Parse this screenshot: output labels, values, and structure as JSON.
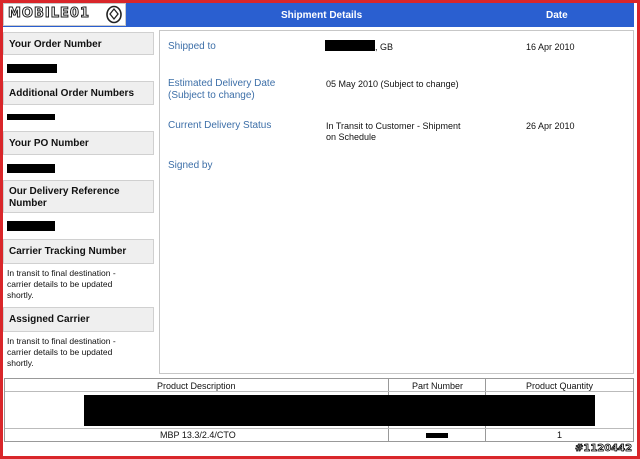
{
  "logo": {
    "text": "MOBILE01"
  },
  "header": {
    "title": "Shipment Details",
    "date_col": "Date"
  },
  "sidebar": {
    "order_number_label": "Your Order Number",
    "additional_orders_label": "Additional Order Numbers",
    "po_number_label": "Your PO Number",
    "delivery_ref_label": "Our Delivery Reference Number",
    "tracking_label": "Carrier Tracking Number",
    "tracking_value": "In transit to final destination - carrier details to be updated shortly.",
    "carrier_label": "Assigned Carrier",
    "carrier_value": "In transit to final destination - carrier details to be updated shortly."
  },
  "details": {
    "shipped_to_label": "Shipped to",
    "shipped_to_value": ", GB",
    "shipped_to_date": "16 Apr 2010",
    "est_delivery_label": "Estimated Delivery Date (Subject to change)",
    "est_delivery_value": "05 May 2010 (Subject to change)",
    "status_label": "Current Delivery Status",
    "status_value": "In Transit to Customer - Shipment on Schedule",
    "status_date": "26 Apr 2010",
    "signed_by_label": "Signed by"
  },
  "products": {
    "headers": [
      "Product Description",
      "Part Number",
      "Product Quantity"
    ],
    "rows": [
      {
        "description": "MBP 13.3/2.4/CTO",
        "part": "",
        "quantity": "1"
      }
    ]
  },
  "watermark": "#1120442"
}
